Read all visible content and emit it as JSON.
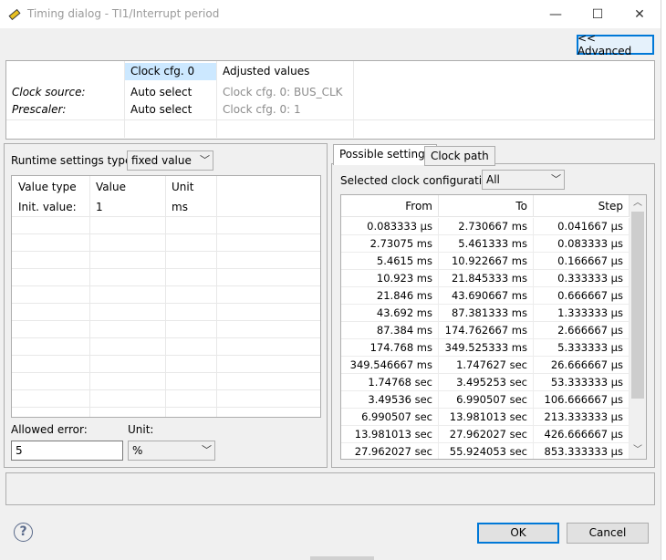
{
  "window": {
    "title": "Timing dialog - TI1/Interrupt period",
    "minimize_glyph": "—",
    "maximize_glyph": "☐",
    "close_glyph": "✕"
  },
  "toolbar": {
    "advanced_label": "<< Advanced"
  },
  "clock_table": {
    "headers": [
      "Clock cfg. 0",
      "Adjusted values"
    ],
    "rows": [
      {
        "label": "Clock source:",
        "value": "Auto select",
        "adjusted": "Clock cfg. 0: BUS_CLK"
      },
      {
        "label": "Prescaler:",
        "value": "Auto select",
        "adjusted": "Clock cfg. 0: 1"
      }
    ]
  },
  "runtime": {
    "label": "Runtime settings type:",
    "selected": "fixed value"
  },
  "value_table": {
    "headers": [
      "Value type",
      "Value",
      "Unit"
    ],
    "rows": [
      [
        "Init. value:",
        "1",
        "ms"
      ]
    ]
  },
  "allowed_error": {
    "label": "Allowed error:",
    "value": "5",
    "unit_label": "Unit:",
    "unit_selected": "%"
  },
  "tabs": [
    {
      "label": "Possible settings",
      "active": true
    },
    {
      "label": "Clock path",
      "active": false
    }
  ],
  "selected_clock_config": {
    "label": "Selected clock configuration",
    "selected": "All"
  },
  "settings_table": {
    "headers": [
      "From",
      "To",
      "Step"
    ],
    "rows": [
      [
        "0.083333 μs",
        "2.730667 ms",
        "0.041667 μs"
      ],
      [
        "2.73075 ms",
        "5.461333 ms",
        "0.083333 μs"
      ],
      [
        "5.4615 ms",
        "10.922667 ms",
        "0.166667 μs"
      ],
      [
        "10.923 ms",
        "21.845333 ms",
        "0.333333 μs"
      ],
      [
        "21.846 ms",
        "43.690667 ms",
        "0.666667 μs"
      ],
      [
        "43.692 ms",
        "87.381333 ms",
        "1.333333 μs"
      ],
      [
        "87.384 ms",
        "174.762667 ms",
        "2.666667 μs"
      ],
      [
        "174.768 ms",
        "349.525333 ms",
        "5.333333 μs"
      ],
      [
        "349.546667 ms",
        "1.747627 sec",
        "26.666667 μs"
      ],
      [
        "1.74768 sec",
        "3.495253 sec",
        "53.333333 μs"
      ],
      [
        "3.49536 sec",
        "6.990507 sec",
        "106.666667 μs"
      ],
      [
        "6.990507 sec",
        "13.981013 sec",
        "213.333333 μs"
      ],
      [
        "13.981013 sec",
        "27.962027 sec",
        "426.666667 μs"
      ],
      [
        "27.962027 sec",
        "55.924053 sec",
        "853.333333 μs"
      ]
    ]
  },
  "footer": {
    "help_glyph": "?",
    "ok_label": "OK",
    "cancel_label": "Cancel"
  }
}
